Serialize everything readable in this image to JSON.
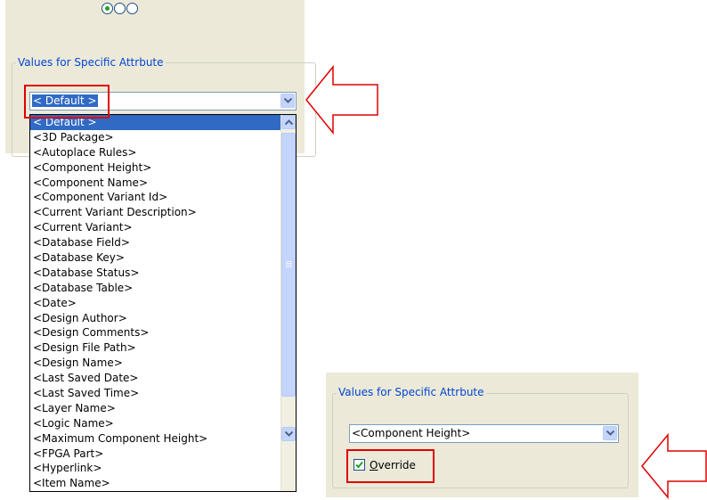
{
  "top_panel": {
    "group_label": "Values for Specific Attrbute",
    "combo_value": "< Default >"
  },
  "dropdown_items": [
    "< Default >",
    "<3D Package>",
    "<Autoplace Rules>",
    "<Component Height>",
    "<Component Name>",
    "<Component Variant Id>",
    "<Current Variant Description>",
    "<Current Variant>",
    "<Database Field>",
    "<Database Key>",
    "<Database Status>",
    "<Database Table>",
    "<Date>",
    "<Design Author>",
    "<Design Comments>",
    "<Design File Path>",
    "<Design Name>",
    "<Last Saved Date>",
    "<Last Saved Time>",
    "<Layer Name>",
    "<Logic Name>",
    "<Maximum Component Height>",
    "<FPGA Part>",
    "<Hyperlink>",
    "<Item Name>"
  ],
  "bottom_panel": {
    "group_label": "Values for Specific Attrbute",
    "combo_value": "<Component Height>",
    "override_label": "Override",
    "override_checked": true
  },
  "colors": {
    "dialog_bg": "#ece9d8",
    "selection": "#316ac5",
    "group_label": "#0046d5",
    "annotation_red": "#e00000"
  },
  "icons": [
    "radio-button-icon",
    "chevron-down-icon",
    "chevron-up-icon",
    "checkmark-icon",
    "arrow-left-icon"
  ]
}
